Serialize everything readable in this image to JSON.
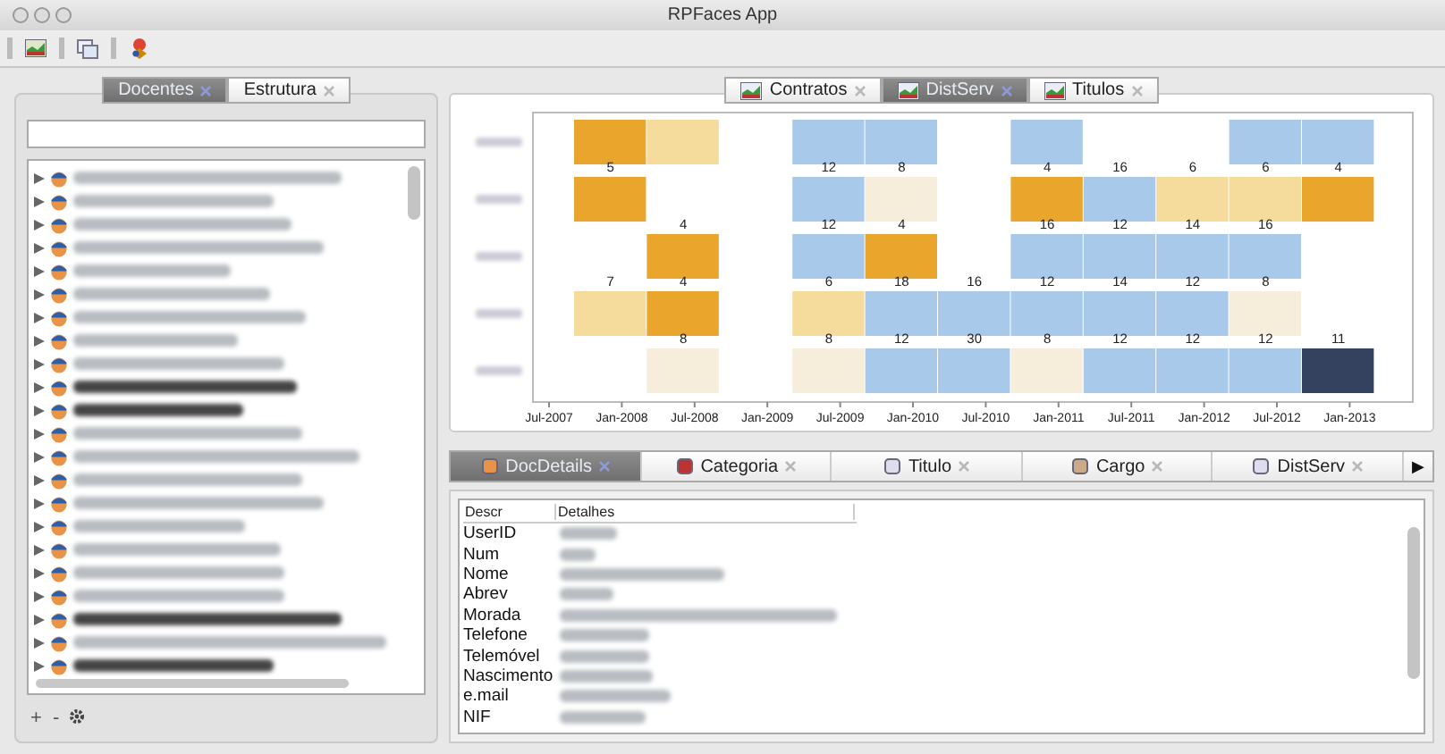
{
  "window": {
    "title": "RPFaces App"
  },
  "left_panel": {
    "tabs": [
      {
        "label": "Docentes",
        "selected": true
      },
      {
        "label": "Estrutura",
        "selected": false
      }
    ],
    "people": [
      {
        "selected": false
      },
      {
        "selected": false
      },
      {
        "selected": false
      },
      {
        "selected": false
      },
      {
        "selected": false
      },
      {
        "selected": false
      },
      {
        "selected": false
      },
      {
        "selected": false
      },
      {
        "selected": false
      },
      {
        "selected": true
      },
      {
        "selected": true
      },
      {
        "selected": false
      },
      {
        "selected": false
      },
      {
        "selected": false
      },
      {
        "selected": false
      },
      {
        "selected": false
      },
      {
        "selected": false
      },
      {
        "selected": false
      },
      {
        "selected": false
      },
      {
        "selected": true
      },
      {
        "selected": false
      },
      {
        "selected": true
      }
    ],
    "buttons": [
      "+",
      "-"
    ]
  },
  "chart_tabs": [
    {
      "label": "Contratos",
      "selected": false
    },
    {
      "label": "DistServ",
      "selected": true
    },
    {
      "label": "Titulos",
      "selected": false
    }
  ],
  "timeline": {
    "xticks": [
      "Jul-2007",
      "Jan-2008",
      "Jul-2008",
      "Jan-2009",
      "Jul-2009",
      "Jan-2010",
      "Jul-2010",
      "Jan-2011",
      "Jul-2011",
      "Jan-2012",
      "Jul-2012",
      "Jan-2013"
    ],
    "rows": [
      {
        "cells": [
          {
            "color": "#e9a52c"
          },
          {
            "color": "#f6dc9c"
          },
          null,
          {
            "color": "#a9c9ea"
          },
          {
            "color": "#a9c9ea"
          },
          null,
          {
            "color": "#a9c9ea"
          },
          null,
          null,
          {
            "color": "#a9c9ea"
          },
          {
            "color": "#a9c9ea"
          }
        ]
      },
      {
        "cells": [
          {
            "value": "5",
            "color": "#e9a52c"
          },
          null,
          null,
          {
            "value": "12",
            "color": "#a9c9ea"
          },
          {
            "value": "8",
            "color": "#f7eddb"
          },
          null,
          {
            "value": "4",
            "color": "#e9a52c"
          },
          {
            "value": "16",
            "color": "#a9c9ea"
          },
          {
            "value": "6",
            "color": "#f6dc9c"
          },
          {
            "value": "6",
            "color": "#f6dc9c"
          },
          {
            "value": "4",
            "color": "#e9a52c"
          }
        ]
      },
      {
        "cells": [
          null,
          {
            "value": "4",
            "color": "#e9a52c"
          },
          null,
          {
            "value": "12",
            "color": "#a9c9ea"
          },
          {
            "value": "4",
            "color": "#e9a52c"
          },
          null,
          {
            "value": "16",
            "color": "#a9c9ea"
          },
          {
            "value": "12",
            "color": "#a9c9ea"
          },
          {
            "value": "14",
            "color": "#a9c9ea"
          },
          {
            "value": "16",
            "color": "#a9c9ea"
          },
          null
        ]
      },
      {
        "cells": [
          {
            "value": "7",
            "color": "#f6dc9c"
          },
          {
            "value": "4",
            "color": "#e9a52c"
          },
          null,
          {
            "value": "6",
            "color": "#f6dc9c"
          },
          {
            "value": "18",
            "color": "#a9c9ea"
          },
          {
            "value": "16",
            "color": "#a9c9ea"
          },
          {
            "value": "12",
            "color": "#a9c9ea"
          },
          {
            "value": "14",
            "color": "#a9c9ea"
          },
          {
            "value": "12",
            "color": "#a9c9ea"
          },
          {
            "value": "8",
            "color": "#f7eddb"
          },
          null
        ]
      },
      {
        "cells": [
          null,
          {
            "value": "8",
            "color": "#f7eddb"
          },
          null,
          {
            "value": "8",
            "color": "#f7eddb"
          },
          {
            "value": "12",
            "color": "#a9c9ea"
          },
          {
            "value": "30",
            "color": "#a9c9ea"
          },
          {
            "value": "8",
            "color": "#f7eddb"
          },
          {
            "value": "12",
            "color": "#a9c9ea"
          },
          {
            "value": "12",
            "color": "#a9c9ea"
          },
          {
            "value": "12",
            "color": "#a9c9ea"
          },
          {
            "value": "11",
            "color": "#34425f"
          }
        ]
      }
    ]
  },
  "detail_tabs": [
    {
      "label": "DocDetails",
      "selected": true
    },
    {
      "label": "Categoria",
      "selected": false
    },
    {
      "label": "Titulo",
      "selected": false
    },
    {
      "label": "Cargo",
      "selected": false
    },
    {
      "label": "DistServ",
      "selected": false
    }
  ],
  "more_tabs": "▶",
  "details": {
    "columns": [
      "Descr",
      "Detalhes"
    ],
    "rows": [
      {
        "label": "UserID"
      },
      {
        "label": "Num"
      },
      {
        "label": "Nome"
      },
      {
        "label": "Abrev"
      },
      {
        "label": "Morada"
      },
      {
        "label": "Telefone"
      },
      {
        "label": "Telemóvel"
      },
      {
        "label": "Nascimento"
      },
      {
        "label": "e.mail"
      },
      {
        "label": "NIF"
      }
    ]
  }
}
